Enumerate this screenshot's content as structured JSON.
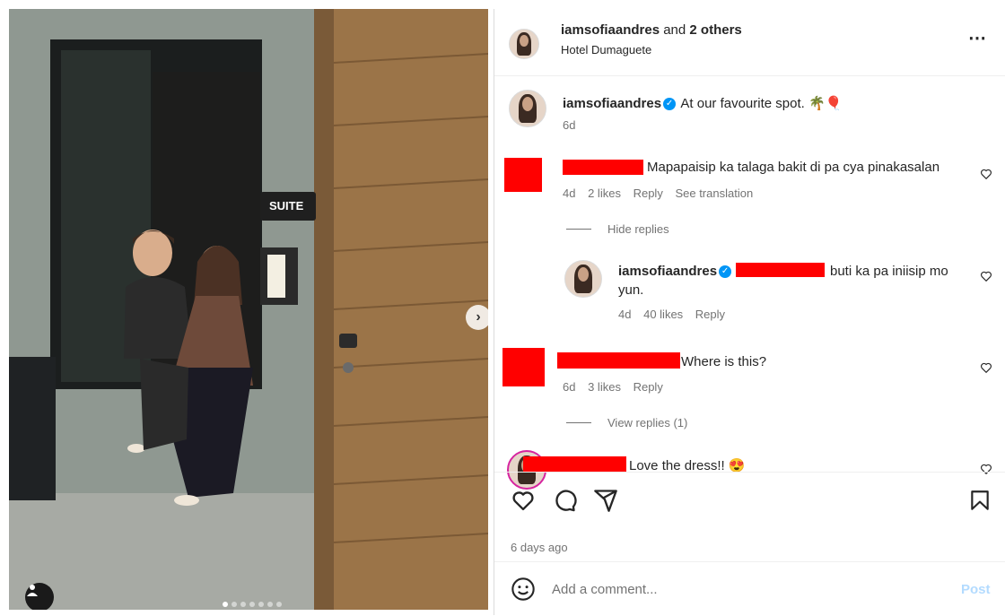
{
  "post": {
    "author": "iamsofiaandres",
    "collab_suffix": "and",
    "collab_count": "2 others",
    "location": "Hotel Dumaguete",
    "caption": "At our favourite spot. 🌴🎈",
    "caption_time": "6d",
    "photo_sign": "SUITE",
    "carousel_count": 7,
    "carousel_active": 1
  },
  "comments": [
    {
      "text": "Mapapaisip ka talaga bakit di pa cya pinakasalan",
      "time": "4d",
      "likes": "2 likes",
      "reply": "Reply",
      "translate": "See translation",
      "toggle": "Hide replies",
      "replies": [
        {
          "author": "iamsofiaandres",
          "text_line1": "buti ka pa iniisip mo",
          "text_line2": "yun.",
          "time": "4d",
          "likes": "40 likes",
          "reply": "Reply"
        }
      ]
    },
    {
      "text": "Where is this?",
      "time": "6d",
      "likes": "3 likes",
      "reply": "Reply",
      "toggle": "View replies (1)"
    },
    {
      "text": "Love the dress!! 😍"
    }
  ],
  "footer": {
    "timestamp": "6 days ago",
    "comment_placeholder": "Add a comment...",
    "post_label": "Post"
  },
  "colors": {
    "verified": "#0095f6",
    "redaction": "#ff0000",
    "muted": "#737373",
    "post_disabled": "#b3dbff"
  },
  "icons": [
    "more-options-icon",
    "heart-icon",
    "comment-icon",
    "share-icon",
    "bookmark-icon",
    "emoji-icon",
    "next-arrow-icon",
    "user-tag-icon",
    "verified-icon"
  ]
}
